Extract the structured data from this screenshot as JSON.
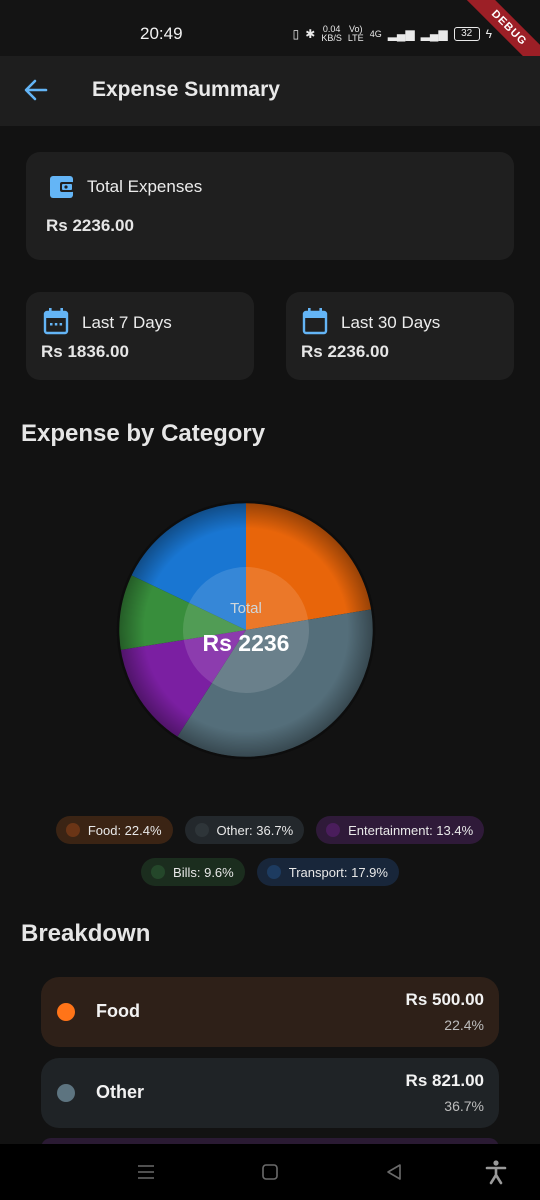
{
  "status_bar": {
    "time": "20:49",
    "net_speed": "0.04\nKB/S",
    "volte": "Vo)\nLTE",
    "network": "4G",
    "battery": "32",
    "debug_label": "DEBUG"
  },
  "app_bar": {
    "title": "Expense Summary",
    "back_icon": "arrow-left-icon"
  },
  "total_card": {
    "icon": "wallet-icon",
    "label": "Total Expenses",
    "value": "Rs 2236.00"
  },
  "week_card": {
    "icon": "calendar-icon",
    "label": "Last 7 Days",
    "value": "Rs 1836.00"
  },
  "month_card": {
    "icon": "calendar-icon",
    "label": "Last 30 Days",
    "value": "Rs 2236.00"
  },
  "category_section": {
    "title": "Expense by Category"
  },
  "chart_data": {
    "type": "pie",
    "center_label": "Total",
    "center_value": "Rs 2236",
    "slices": [
      {
        "label": "Food",
        "value": 22.4,
        "color": "#e8650a"
      },
      {
        "label": "Other",
        "value": 36.7,
        "color": "#546e7a"
      },
      {
        "label": "Entertainment",
        "value": 13.4,
        "color": "#7b1fa2"
      },
      {
        "label": "Bills",
        "value": 9.6,
        "color": "#388e3c"
      },
      {
        "label": "Transport",
        "value": 17.9,
        "color": "#1976d2"
      }
    ]
  },
  "legend": [
    {
      "text": "Food: 22.4%",
      "dot": "#6b3516",
      "bg": "#3b2414"
    },
    {
      "text": "Other: 36.7%",
      "dot": "#2e3539",
      "bg": "#23282c"
    },
    {
      "text": "Entertainment: 13.4%",
      "dot": "#4a1d5c",
      "bg": "#2f1a39"
    },
    {
      "text": "Bills: 9.6%",
      "dot": "#24472a",
      "bg": "#1b2d1e"
    },
    {
      "text": "Transport: 17.9%",
      "dot": "#1d3b60",
      "bg": "#18263a"
    }
  ],
  "breakdown": {
    "title": "Breakdown",
    "items": [
      {
        "name": "Food",
        "amount": "Rs 500.00",
        "percent": "22.4%",
        "dot": "#ff7418",
        "bg": "#2e2018"
      },
      {
        "name": "Other",
        "amount": "Rs 821.00",
        "percent": "36.7%",
        "dot": "#5d7480",
        "bg": "#1f2326"
      }
    ]
  },
  "nav_bar": {
    "icons": [
      "menu-icon",
      "home-icon",
      "back-icon",
      "accessibility-icon"
    ]
  }
}
